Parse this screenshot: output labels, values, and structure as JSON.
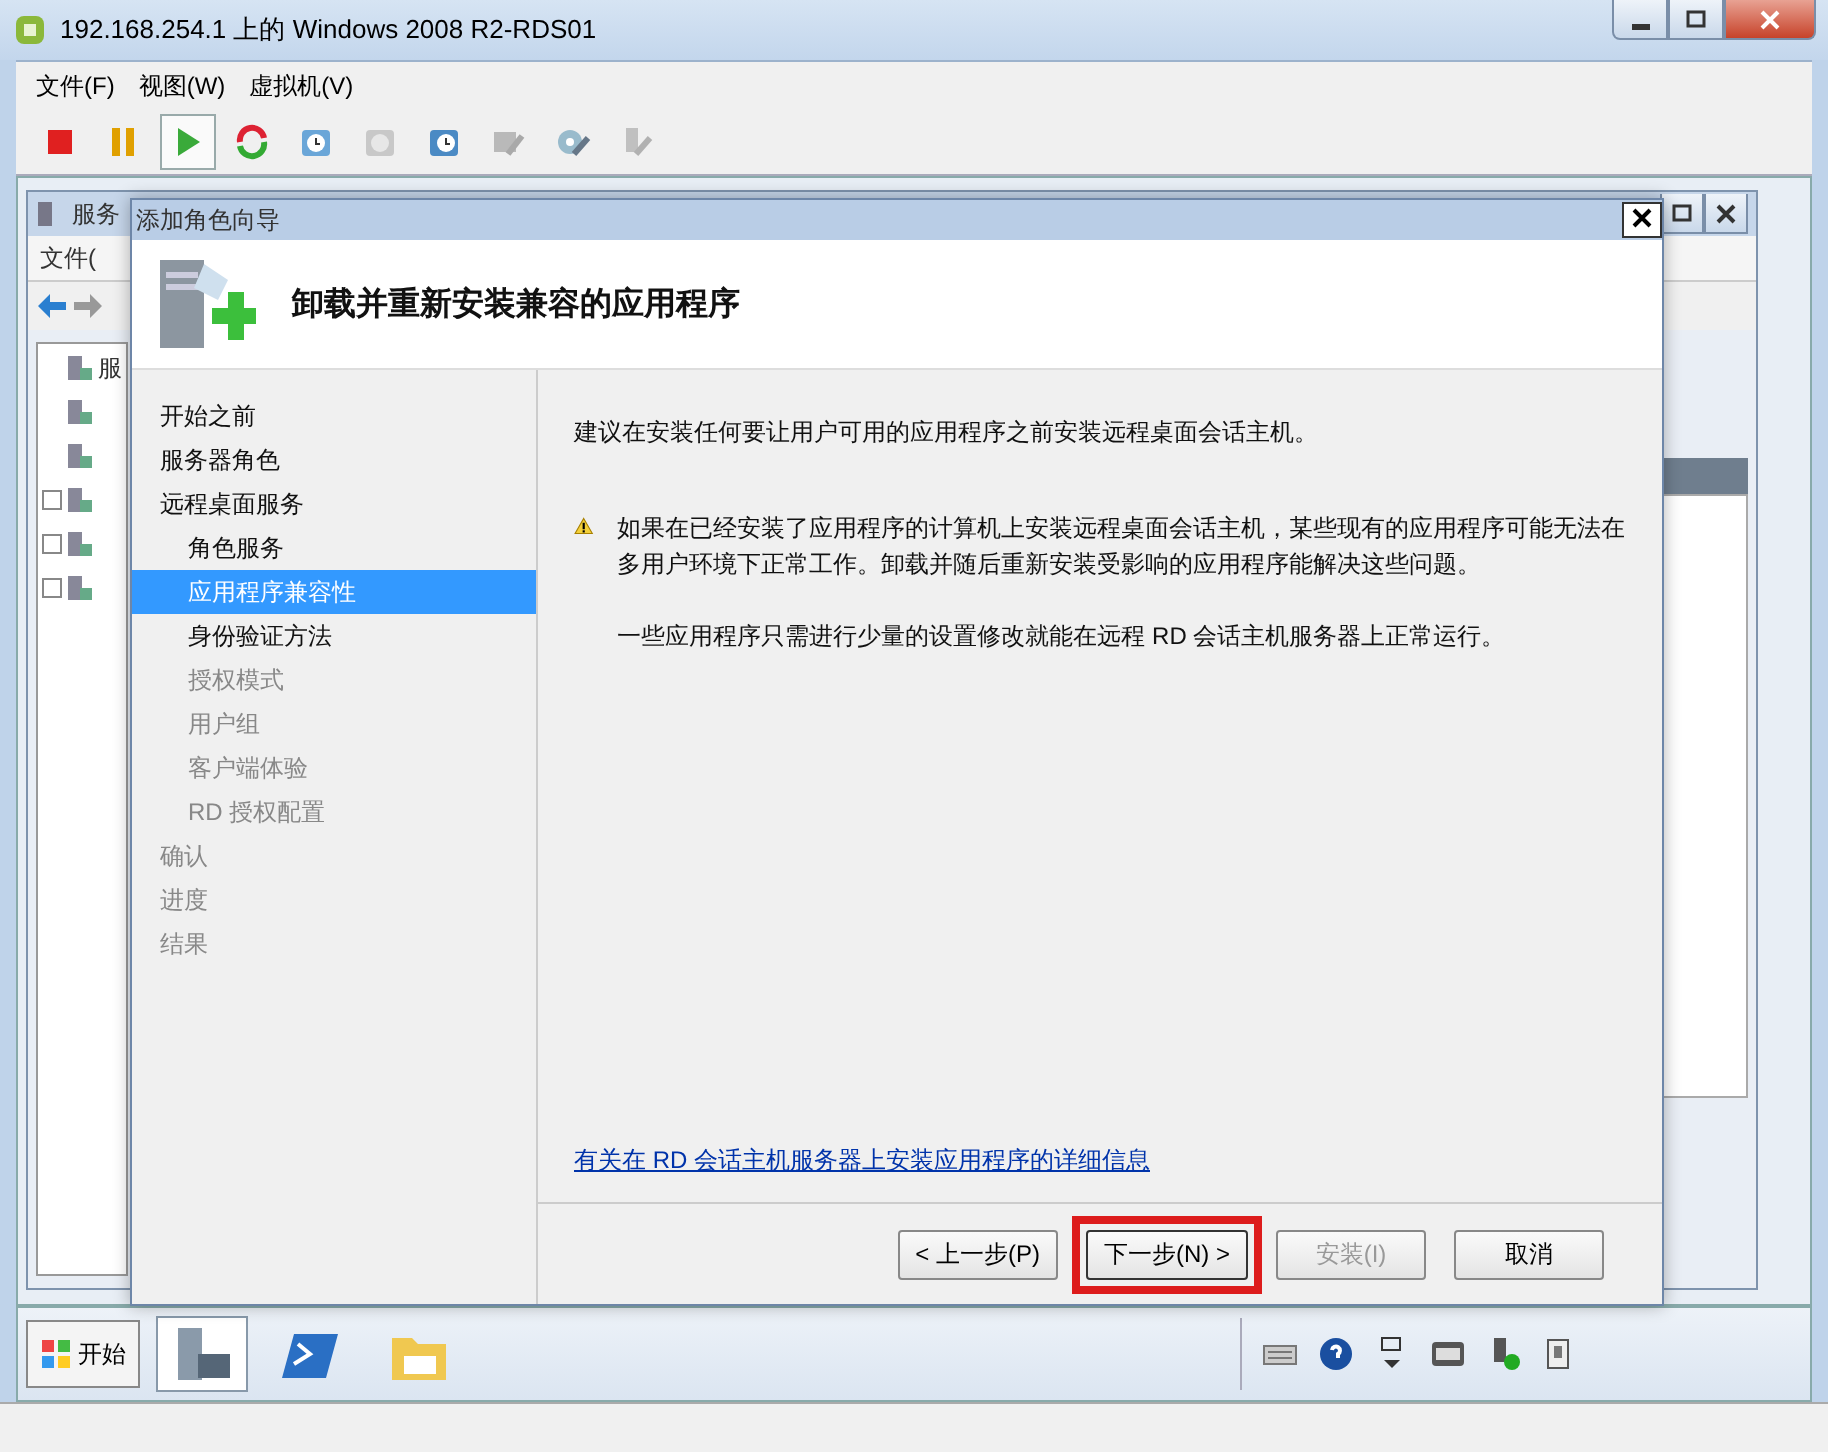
{
  "window": {
    "title": "192.168.254.1 上的 Windows 2008 R2-RDS01"
  },
  "menu": [
    "文件(F)",
    "视图(W)",
    "虚拟机(V)"
  ],
  "toolbar": [
    {
      "kind": "stop",
      "disabled": false,
      "selected": false
    },
    {
      "kind": "pause",
      "disabled": false,
      "selected": false
    },
    {
      "kind": "play",
      "disabled": false,
      "selected": true
    },
    {
      "kind": "reset",
      "disabled": false,
      "selected": false
    },
    {
      "kind": "snapshot",
      "disabled": false,
      "selected": false
    },
    {
      "kind": "revert",
      "disabled": true,
      "selected": false
    },
    {
      "kind": "manage",
      "disabled": false,
      "selected": false
    },
    {
      "kind": "settings",
      "disabled": true,
      "selected": false
    },
    {
      "kind": "media",
      "disabled": false,
      "selected": false
    },
    {
      "kind": "usb",
      "disabled": true,
      "selected": false
    }
  ],
  "server_manager": {
    "title": "服务",
    "menu": "文件(",
    "tree": [
      {
        "label": "服",
        "expandable": false
      },
      {
        "expandable": false
      },
      {
        "expandable": false
      },
      {
        "expandable": true
      },
      {
        "expandable": true
      },
      {
        "expandable": true
      }
    ]
  },
  "wizard": {
    "title": "添加角色向导",
    "heading": "卸载并重新安装兼容的应用程序",
    "steps": [
      {
        "label": "开始之前",
        "selected": false,
        "disabled": false
      },
      {
        "label": "服务器角色",
        "selected": false,
        "disabled": false
      },
      {
        "label": "远程桌面服务",
        "selected": false,
        "disabled": false,
        "children": [
          {
            "label": "角色服务",
            "selected": false,
            "disabled": false
          },
          {
            "label": "应用程序兼容性",
            "selected": true,
            "disabled": false
          },
          {
            "label": "身份验证方法",
            "selected": false,
            "disabled": false
          },
          {
            "label": "授权模式",
            "selected": false,
            "disabled": true
          },
          {
            "label": "用户组",
            "selected": false,
            "disabled": true
          },
          {
            "label": "客户端体验",
            "selected": false,
            "disabled": true
          },
          {
            "label": "RD 授权配置",
            "selected": false,
            "disabled": true
          }
        ]
      },
      {
        "label": "确认",
        "selected": false,
        "disabled": true
      },
      {
        "label": "进度",
        "selected": false,
        "disabled": true
      },
      {
        "label": "结果",
        "selected": false,
        "disabled": true
      }
    ],
    "intro": "建议在安装任何要让用户可用的应用程序之前安装远程桌面会话主机。",
    "warning": "如果在已经安装了应用程序的计算机上安装远程桌面会话主机，某些现有的应用程序可能无法在多用户环境下正常工作。卸载并随后重新安装受影响的应用程序能解决这些问题。",
    "note": "一些应用程序只需进行少量的设置修改就能在远程 RD 会话主机服务器上正常运行。",
    "link": "有关在 RD 会话主机服务器上安装应用程序的详细信息",
    "buttons": [
      {
        "label": "< 上一步(P)",
        "disabled": false,
        "highlighted": false,
        "focused": false
      },
      {
        "label": "下一步(N) >",
        "disabled": false,
        "highlighted": true,
        "focused": true
      },
      {
        "label": "安装(I)",
        "disabled": true,
        "highlighted": false,
        "focused": false
      },
      {
        "label": "取消",
        "disabled": false,
        "highlighted": false,
        "focused": false
      }
    ]
  },
  "taskbar": {
    "start": "开始",
    "apps": [
      {
        "kind": "server",
        "selected": true
      },
      {
        "kind": "shell",
        "selected": false
      },
      {
        "kind": "folder",
        "selected": false
      }
    ],
    "tray": [
      {
        "kind": "keyboard"
      },
      {
        "kind": "help"
      },
      {
        "kind": "window"
      },
      {
        "kind": "vm"
      },
      {
        "kind": "network"
      },
      {
        "kind": "device"
      }
    ]
  }
}
